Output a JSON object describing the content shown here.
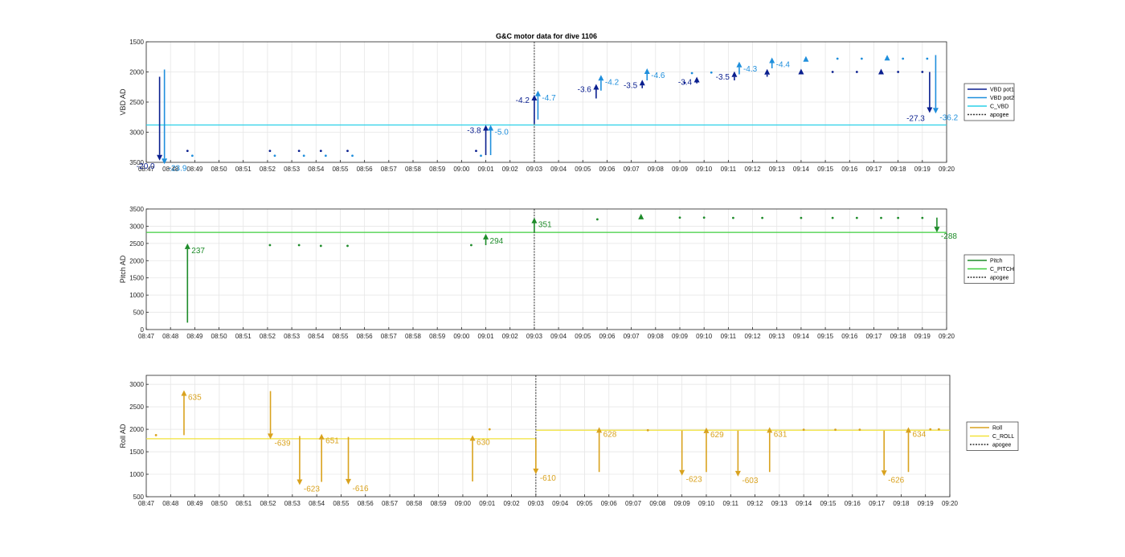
{
  "title": "G&C motor data for dive 1106",
  "colors": {
    "vbd_pot1": "#0a1f8f",
    "vbd_pot2": "#1f8fdc",
    "c_vbd": "#2ad0e8",
    "pitch": "#1e8c2a",
    "c_pitch": "#3fcf3f",
    "roll": "#d9a21e",
    "c_roll": "#f2e23a",
    "apogee": "#333333",
    "grid": "#e6e6e6"
  },
  "chart_data": [
    {
      "type": "line",
      "title": "G&C motor data for dive 1106",
      "ylabel": "VBD AD",
      "ylim": [
        1500,
        3500
      ],
      "y_reversed": true,
      "yticks": [
        1500,
        2000,
        2500,
        3000,
        3500
      ],
      "xticks": [
        "08:47",
        "08:48",
        "08:49",
        "08:50",
        "08:51",
        "08:52",
        "08:53",
        "08:54",
        "08:55",
        "08:56",
        "08:57",
        "08:58",
        "08:59",
        "09:00",
        "09:01",
        "09:02",
        "09:03",
        "09:04",
        "09:05",
        "09:06",
        "09:07",
        "09:08",
        "09:09",
        "09:10",
        "09:11",
        "09:12",
        "09:13",
        "09:14",
        "09:15",
        "09:16",
        "09:17",
        "09:18",
        "09:19",
        "09:20"
      ],
      "grid": true,
      "legend_position": "right",
      "legend": [
        "VBD pot1",
        "VBD pot2",
        "C_VBD",
        "apogee"
      ],
      "apogee_min": 16,
      "hlines": [
        {
          "series": "C_VBD",
          "y": 2880
        }
      ],
      "arrows": [
        {
          "series": "VBD pot1",
          "t": 0.55,
          "from": 2080,
          "to": 3470,
          "label": "-20.0"
        },
        {
          "series": "VBD pot2",
          "t": 0.75,
          "from": 1960,
          "to": 3530,
          "label": "-23.9"
        },
        {
          "series": "VBD pot1",
          "t": 14.0,
          "from": 3380,
          "to": 2880,
          "label": "-3.8"
        },
        {
          "series": "VBD pot2",
          "t": 14.2,
          "from": 3380,
          "to": 2880,
          "label": "-5.0"
        },
        {
          "series": "VBD pot1",
          "t": 16.0,
          "from": 2860,
          "to": 2380,
          "label": "-4.2"
        },
        {
          "series": "VBD pot2",
          "t": 16.15,
          "from": 2790,
          "to": 2310,
          "label": "-4.7"
        },
        {
          "series": "VBD pot1",
          "t": 18.55,
          "from": 2440,
          "to": 2200,
          "label": "-3.6"
        },
        {
          "series": "VBD pot2",
          "t": 18.75,
          "from": 2310,
          "to": 2050,
          "label": "-4.2"
        },
        {
          "series": "VBD pot1",
          "t": 20.45,
          "from": 2270,
          "to": 2130,
          "label": "-3.5"
        },
        {
          "series": "VBD pot2",
          "t": 20.65,
          "from": 2140,
          "to": 1940,
          "label": "-4.6"
        },
        {
          "series": "VBD pot1",
          "t": 22.7,
          "from": 2190,
          "to": 2080,
          "label": "-3.4"
        },
        {
          "series": "VBD pot1",
          "t": 24.25,
          "from": 2140,
          "to": 1990,
          "label": "-3.5"
        },
        {
          "series": "VBD pot2",
          "t": 24.45,
          "from": 2040,
          "to": 1830,
          "label": "-4.3"
        },
        {
          "series": "VBD pot1",
          "t": 25.6,
          "from": 2080,
          "to": 1950,
          "label": ""
        },
        {
          "series": "VBD pot2",
          "t": 25.8,
          "from": 1940,
          "to": 1760,
          "label": "-4.4"
        },
        {
          "series": "VBD pot1",
          "t": 32.3,
          "from": 2000,
          "to": 2680,
          "label": "-27.3"
        },
        {
          "series": "VBD pot2",
          "t": 32.55,
          "from": 1720,
          "to": 2690,
          "label": "-36.2"
        }
      ],
      "markers": [
        {
          "series": "VBD pot1",
          "t": 1.7,
          "y": 3310,
          "size": "dot"
        },
        {
          "series": "VBD pot2",
          "t": 1.9,
          "y": 3390,
          "size": "dot"
        },
        {
          "series": "VBD pot1",
          "t": 5.1,
          "y": 3310,
          "size": "dot"
        },
        {
          "series": "VBD pot2",
          "t": 5.3,
          "y": 3390,
          "size": "dot"
        },
        {
          "series": "VBD pot1",
          "t": 6.3,
          "y": 3310,
          "size": "dot"
        },
        {
          "series": "VBD pot2",
          "t": 6.5,
          "y": 3390,
          "size": "dot"
        },
        {
          "series": "VBD pot1",
          "t": 7.2,
          "y": 3310,
          "size": "dot"
        },
        {
          "series": "VBD pot2",
          "t": 7.4,
          "y": 3390,
          "size": "dot"
        },
        {
          "series": "VBD pot1",
          "t": 8.3,
          "y": 3310,
          "size": "dot"
        },
        {
          "series": "VBD pot2",
          "t": 8.5,
          "y": 3390,
          "size": "dot"
        },
        {
          "series": "VBD pot1",
          "t": 13.6,
          "y": 3310,
          "size": "dot"
        },
        {
          "series": "VBD pot2",
          "t": 13.8,
          "y": 3390,
          "size": "dot"
        },
        {
          "series": "VBD pot1",
          "t": 22.2,
          "y": 2180,
          "size": "dot"
        },
        {
          "series": "VBD pot2",
          "t": 22.5,
          "y": 2020,
          "size": "dot"
        },
        {
          "series": "VBD pot2",
          "t": 23.3,
          "y": 2010,
          "size": "dot"
        },
        {
          "series": "VBD pot1",
          "t": 27.0,
          "y": 2000,
          "size": "big"
        },
        {
          "series": "VBD pot2",
          "t": 27.2,
          "y": 1790,
          "size": "big"
        },
        {
          "series": "VBD pot1",
          "t": 28.3,
          "y": 2000,
          "size": "dot"
        },
        {
          "series": "VBD pot2",
          "t": 28.5,
          "y": 1780,
          "size": "dot"
        },
        {
          "series": "VBD pot1",
          "t": 29.3,
          "y": 2000,
          "size": "dot"
        },
        {
          "series": "VBD pot2",
          "t": 29.5,
          "y": 1780,
          "size": "dot"
        },
        {
          "series": "VBD pot1",
          "t": 30.3,
          "y": 2000,
          "size": "big"
        },
        {
          "series": "VBD pot2",
          "t": 30.55,
          "y": 1770,
          "size": "big"
        },
        {
          "series": "VBD pot1",
          "t": 31.0,
          "y": 2000,
          "size": "dot"
        },
        {
          "series": "VBD pot2",
          "t": 31.2,
          "y": 1780,
          "size": "dot"
        },
        {
          "series": "VBD pot1",
          "t": 32.0,
          "y": 2000,
          "size": "dot"
        },
        {
          "series": "VBD pot2",
          "t": 32.2,
          "y": 1780,
          "size": "dot"
        }
      ]
    },
    {
      "type": "line",
      "ylabel": "Pitch AD",
      "ylim": [
        0,
        3500
      ],
      "y_reversed": false,
      "yticks": [
        0,
        500,
        1000,
        1500,
        2000,
        2500,
        3000,
        3500
      ],
      "xticks": [
        "08:47",
        "08:48",
        "08:49",
        "08:50",
        "08:51",
        "08:52",
        "08:53",
        "08:54",
        "08:55",
        "08:56",
        "08:57",
        "08:58",
        "08:59",
        "09:00",
        "09:01",
        "09:02",
        "09:03",
        "09:04",
        "09:05",
        "09:06",
        "09:07",
        "09:08",
        "09:09",
        "09:10",
        "09:11",
        "09:12",
        "09:13",
        "09:14",
        "09:15",
        "09:16",
        "09:17",
        "09:18",
        "09:19",
        "09:20"
      ],
      "grid": true,
      "legend_position": "right",
      "legend": [
        "Pitch",
        "C_PITCH",
        "apogee"
      ],
      "apogee_min": 16,
      "hlines": [
        {
          "series": "C_PITCH",
          "y": 2820
        }
      ],
      "arrows": [
        {
          "series": "Pitch",
          "t": 1.7,
          "from": 200,
          "to": 2500,
          "label": "237"
        },
        {
          "series": "Pitch",
          "t": 14.0,
          "from": 2450,
          "to": 2780,
          "label": "294"
        },
        {
          "series": "Pitch",
          "t": 16.0,
          "from": 2830,
          "to": 3250,
          "label": "351"
        },
        {
          "series": "Pitch",
          "t": 32.6,
          "from": 3250,
          "to": 2820,
          "label": "-288"
        }
      ],
      "markers": [
        {
          "series": "Pitch",
          "t": 5.1,
          "y": 2450,
          "size": "dot"
        },
        {
          "series": "Pitch",
          "t": 6.3,
          "y": 2450,
          "size": "dot"
        },
        {
          "series": "Pitch",
          "t": 7.2,
          "y": 2430,
          "size": "dot"
        },
        {
          "series": "Pitch",
          "t": 8.3,
          "y": 2430,
          "size": "dot"
        },
        {
          "series": "Pitch",
          "t": 13.4,
          "y": 2450,
          "size": "dot"
        },
        {
          "series": "Pitch",
          "t": 18.6,
          "y": 3200,
          "size": "dot"
        },
        {
          "series": "Pitch",
          "t": 20.4,
          "y": 3270,
          "size": "big"
        },
        {
          "series": "Pitch",
          "t": 22.0,
          "y": 3250,
          "size": "dot"
        },
        {
          "series": "Pitch",
          "t": 23.0,
          "y": 3250,
          "size": "dot"
        },
        {
          "series": "Pitch",
          "t": 24.2,
          "y": 3240,
          "size": "dot"
        },
        {
          "series": "Pitch",
          "t": 25.4,
          "y": 3240,
          "size": "dot"
        },
        {
          "series": "Pitch",
          "t": 27.0,
          "y": 3240,
          "size": "dot"
        },
        {
          "series": "Pitch",
          "t": 28.3,
          "y": 3240,
          "size": "dot"
        },
        {
          "series": "Pitch",
          "t": 29.3,
          "y": 3240,
          "size": "dot"
        },
        {
          "series": "Pitch",
          "t": 30.3,
          "y": 3240,
          "size": "dot"
        },
        {
          "series": "Pitch",
          "t": 31.0,
          "y": 3240,
          "size": "dot"
        },
        {
          "series": "Pitch",
          "t": 32.0,
          "y": 3240,
          "size": "dot"
        }
      ]
    },
    {
      "type": "line",
      "ylabel": "Roll AD",
      "ylim": [
        500,
        3200
      ],
      "y_reversed": false,
      "yticks": [
        500,
        1000,
        1500,
        2000,
        2500,
        3000
      ],
      "xticks": [
        "08:47",
        "08:48",
        "08:49",
        "08:50",
        "08:51",
        "08:52",
        "08:53",
        "08:54",
        "08:55",
        "08:56",
        "08:57",
        "08:58",
        "08:59",
        "09:00",
        "09:01",
        "09:02",
        "09:03",
        "09:04",
        "09:05",
        "09:06",
        "09:07",
        "09:08",
        "09:09",
        "09:10",
        "09:11",
        "09:12",
        "09:13",
        "09:14",
        "09:15",
        "09:16",
        "09:17",
        "09:18",
        "09:19",
        "09:20"
      ],
      "grid": true,
      "legend_position": "right",
      "legend": [
        "Roll",
        "C_ROLL",
        "apogee"
      ],
      "apogee_min": 16,
      "hlines": [
        {
          "series": "C_ROLL",
          "x0": 0,
          "x1": 16,
          "y": 1790
        },
        {
          "series": "C_ROLL",
          "x0": 16,
          "x1": 33,
          "y": 1980
        }
      ],
      "arrows": [
        {
          "series": "Roll",
          "t": 1.55,
          "from": 1870,
          "to": 2870,
          "label": "635"
        },
        {
          "series": "Roll",
          "t": 5.1,
          "from": 2850,
          "to": 1780,
          "label": "-639"
        },
        {
          "series": "Roll",
          "t": 6.3,
          "from": 1850,
          "to": 760,
          "label": "-623"
        },
        {
          "series": "Roll",
          "t": 7.2,
          "from": 830,
          "to": 1900,
          "label": "651"
        },
        {
          "series": "Roll",
          "t": 8.3,
          "from": 1830,
          "to": 770,
          "label": "-616"
        },
        {
          "series": "Roll",
          "t": 13.4,
          "from": 840,
          "to": 1870,
          "label": "630"
        },
        {
          "series": "Roll",
          "t": 16.0,
          "from": 1790,
          "to": 1000,
          "label": "-610"
        },
        {
          "series": "Roll",
          "t": 18.6,
          "from": 1050,
          "to": 2050,
          "label": "628"
        },
        {
          "series": "Roll",
          "t": 22.0,
          "from": 1970,
          "to": 970,
          "label": "-623"
        },
        {
          "series": "Roll",
          "t": 23.0,
          "from": 1050,
          "to": 2040,
          "label": "629"
        },
        {
          "series": "Roll",
          "t": 24.3,
          "from": 1970,
          "to": 950,
          "label": "-603"
        },
        {
          "series": "Roll",
          "t": 25.6,
          "from": 1050,
          "to": 2050,
          "label": "631"
        },
        {
          "series": "Roll",
          "t": 30.3,
          "from": 1970,
          "to": 960,
          "label": "-626"
        },
        {
          "series": "Roll",
          "t": 31.3,
          "from": 1050,
          "to": 2050,
          "label": "634"
        }
      ],
      "markers": [
        {
          "series": "Roll",
          "t": 0.4,
          "y": 1870,
          "size": "dot"
        },
        {
          "series": "Roll",
          "t": 14.1,
          "y": 2000,
          "size": "dot"
        },
        {
          "series": "Roll",
          "t": 20.6,
          "y": 1980,
          "size": "dot"
        },
        {
          "series": "Roll",
          "t": 27.0,
          "y": 1990,
          "size": "dot"
        },
        {
          "series": "Roll",
          "t": 28.3,
          "y": 1990,
          "size": "dot"
        },
        {
          "series": "Roll",
          "t": 29.3,
          "y": 1990,
          "size": "dot"
        },
        {
          "series": "Roll",
          "t": 32.2,
          "y": 2000,
          "size": "dot"
        },
        {
          "series": "Roll",
          "t": 32.55,
          "y": 2000,
          "size": "dot"
        }
      ]
    }
  ]
}
